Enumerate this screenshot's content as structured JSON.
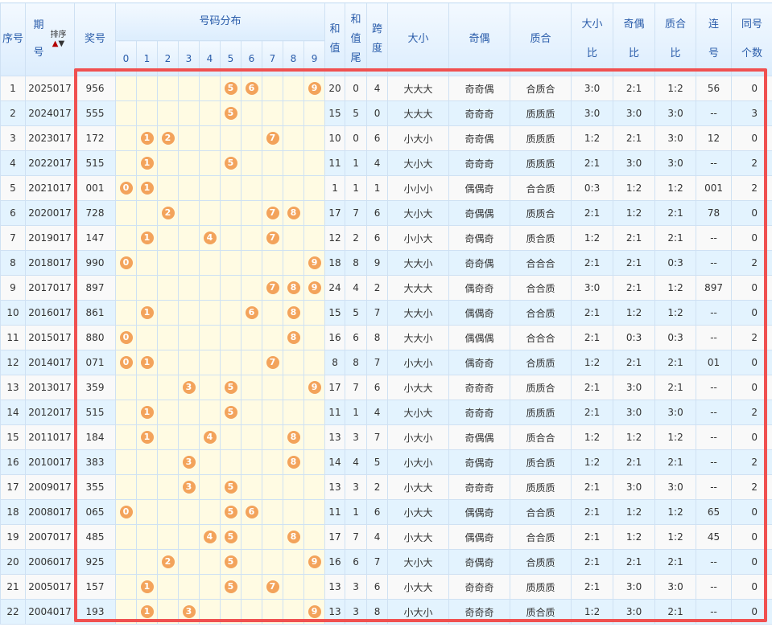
{
  "header": {
    "seq": "序号",
    "period_a": "期",
    "period_b": "号",
    "sort_label": "排序",
    "sort_up": "▲",
    "sort_down": "▼",
    "number": "奖号",
    "distribution": "号码分布",
    "digits": [
      "0",
      "1",
      "2",
      "3",
      "4",
      "5",
      "6",
      "7",
      "8",
      "9"
    ],
    "sum_a": "和",
    "sum_b": "值",
    "tail_a": "和",
    "tail_b": "值",
    "tail_c": "尾",
    "span_a": "跨",
    "span_b": "度",
    "daxiao": "大小",
    "jiou": "奇偶",
    "zhihe": "质合",
    "dxb_a": "大小",
    "dxb_b": "比",
    "job_a": "奇偶",
    "job_b": "比",
    "zhb_a": "质合",
    "zhb_b": "比",
    "lian_a": "连",
    "lian_b": "号",
    "tong_a": "同号",
    "tong_b": "个数"
  },
  "colors": {
    "ball": "#f3a35b",
    "highlight": "#f05050",
    "header_text": "#2a5caa"
  },
  "rows": [
    [
      "1",
      "2025017",
      "956",
      "20",
      "0",
      "4",
      "大大大",
      "奇奇偶",
      "合质合",
      "3:0",
      "2:1",
      "1:2",
      "56",
      "0"
    ],
    [
      "2",
      "2024017",
      "555",
      "15",
      "5",
      "0",
      "大大大",
      "奇奇奇",
      "质质质",
      "3:0",
      "3:0",
      "3:0",
      "--",
      "3"
    ],
    [
      "3",
      "2023017",
      "172",
      "10",
      "0",
      "6",
      "小大小",
      "奇奇偶",
      "质质质",
      "1:2",
      "2:1",
      "3:0",
      "12",
      "0"
    ],
    [
      "4",
      "2022017",
      "515",
      "11",
      "1",
      "4",
      "大小大",
      "奇奇奇",
      "质质质",
      "2:1",
      "3:0",
      "3:0",
      "--",
      "2"
    ],
    [
      "5",
      "2021017",
      "001",
      "1",
      "1",
      "1",
      "小小小",
      "偶偶奇",
      "合合质",
      "0:3",
      "1:2",
      "1:2",
      "001",
      "2"
    ],
    [
      "6",
      "2020017",
      "728",
      "17",
      "7",
      "6",
      "大小大",
      "奇偶偶",
      "质质合",
      "2:1",
      "1:2",
      "2:1",
      "78",
      "0"
    ],
    [
      "7",
      "2019017",
      "147",
      "12",
      "2",
      "6",
      "小小大",
      "奇偶奇",
      "质合质",
      "1:2",
      "2:1",
      "2:1",
      "--",
      "0"
    ],
    [
      "8",
      "2018017",
      "990",
      "18",
      "8",
      "9",
      "大大小",
      "奇奇偶",
      "合合合",
      "2:1",
      "2:1",
      "0:3",
      "--",
      "2"
    ],
    [
      "9",
      "2017017",
      "897",
      "24",
      "4",
      "2",
      "大大大",
      "偶奇奇",
      "合合质",
      "3:0",
      "2:1",
      "1:2",
      "897",
      "0"
    ],
    [
      "10",
      "2016017",
      "861",
      "15",
      "5",
      "7",
      "大大小",
      "偶偶奇",
      "合合质",
      "2:1",
      "1:2",
      "1:2",
      "--",
      "0"
    ],
    [
      "11",
      "2015017",
      "880",
      "16",
      "6",
      "8",
      "大大小",
      "偶偶偶",
      "合合合",
      "2:1",
      "0:3",
      "0:3",
      "--",
      "2"
    ],
    [
      "12",
      "2014017",
      "071",
      "8",
      "8",
      "7",
      "小大小",
      "偶奇奇",
      "合质质",
      "1:2",
      "2:1",
      "2:1",
      "01",
      "0"
    ],
    [
      "13",
      "2013017",
      "359",
      "17",
      "7",
      "6",
      "小大大",
      "奇奇奇",
      "质质合",
      "2:1",
      "3:0",
      "2:1",
      "--",
      "0"
    ],
    [
      "14",
      "2012017",
      "515",
      "11",
      "1",
      "4",
      "大小大",
      "奇奇奇",
      "质质质",
      "2:1",
      "3:0",
      "3:0",
      "--",
      "2"
    ],
    [
      "15",
      "2011017",
      "184",
      "13",
      "3",
      "7",
      "小大小",
      "奇偶偶",
      "质合合",
      "1:2",
      "1:2",
      "1:2",
      "--",
      "0"
    ],
    [
      "16",
      "2010017",
      "383",
      "14",
      "4",
      "5",
      "小大小",
      "奇偶奇",
      "质合质",
      "1:2",
      "2:1",
      "2:1",
      "--",
      "2"
    ],
    [
      "17",
      "2009017",
      "355",
      "13",
      "3",
      "2",
      "小大大",
      "奇奇奇",
      "质质质",
      "2:1",
      "3:0",
      "3:0",
      "--",
      "2"
    ],
    [
      "18",
      "2008017",
      "065",
      "11",
      "1",
      "6",
      "小大大",
      "偶偶奇",
      "合合质",
      "2:1",
      "1:2",
      "1:2",
      "65",
      "0"
    ],
    [
      "19",
      "2007017",
      "485",
      "17",
      "7",
      "4",
      "小大大",
      "偶偶奇",
      "合合质",
      "2:1",
      "1:2",
      "1:2",
      "45",
      "0"
    ],
    [
      "20",
      "2006017",
      "925",
      "16",
      "6",
      "7",
      "大小大",
      "奇偶奇",
      "合质质",
      "2:1",
      "2:1",
      "2:1",
      "--",
      "0"
    ],
    [
      "21",
      "2005017",
      "157",
      "13",
      "3",
      "6",
      "小大大",
      "奇奇奇",
      "质质质",
      "2:1",
      "3:0",
      "3:0",
      "--",
      "0"
    ],
    [
      "22",
      "2004017",
      "193",
      "13",
      "3",
      "8",
      "小大小",
      "奇奇奇",
      "质合质",
      "1:2",
      "3:0",
      "2:1",
      "--",
      "0"
    ]
  ]
}
